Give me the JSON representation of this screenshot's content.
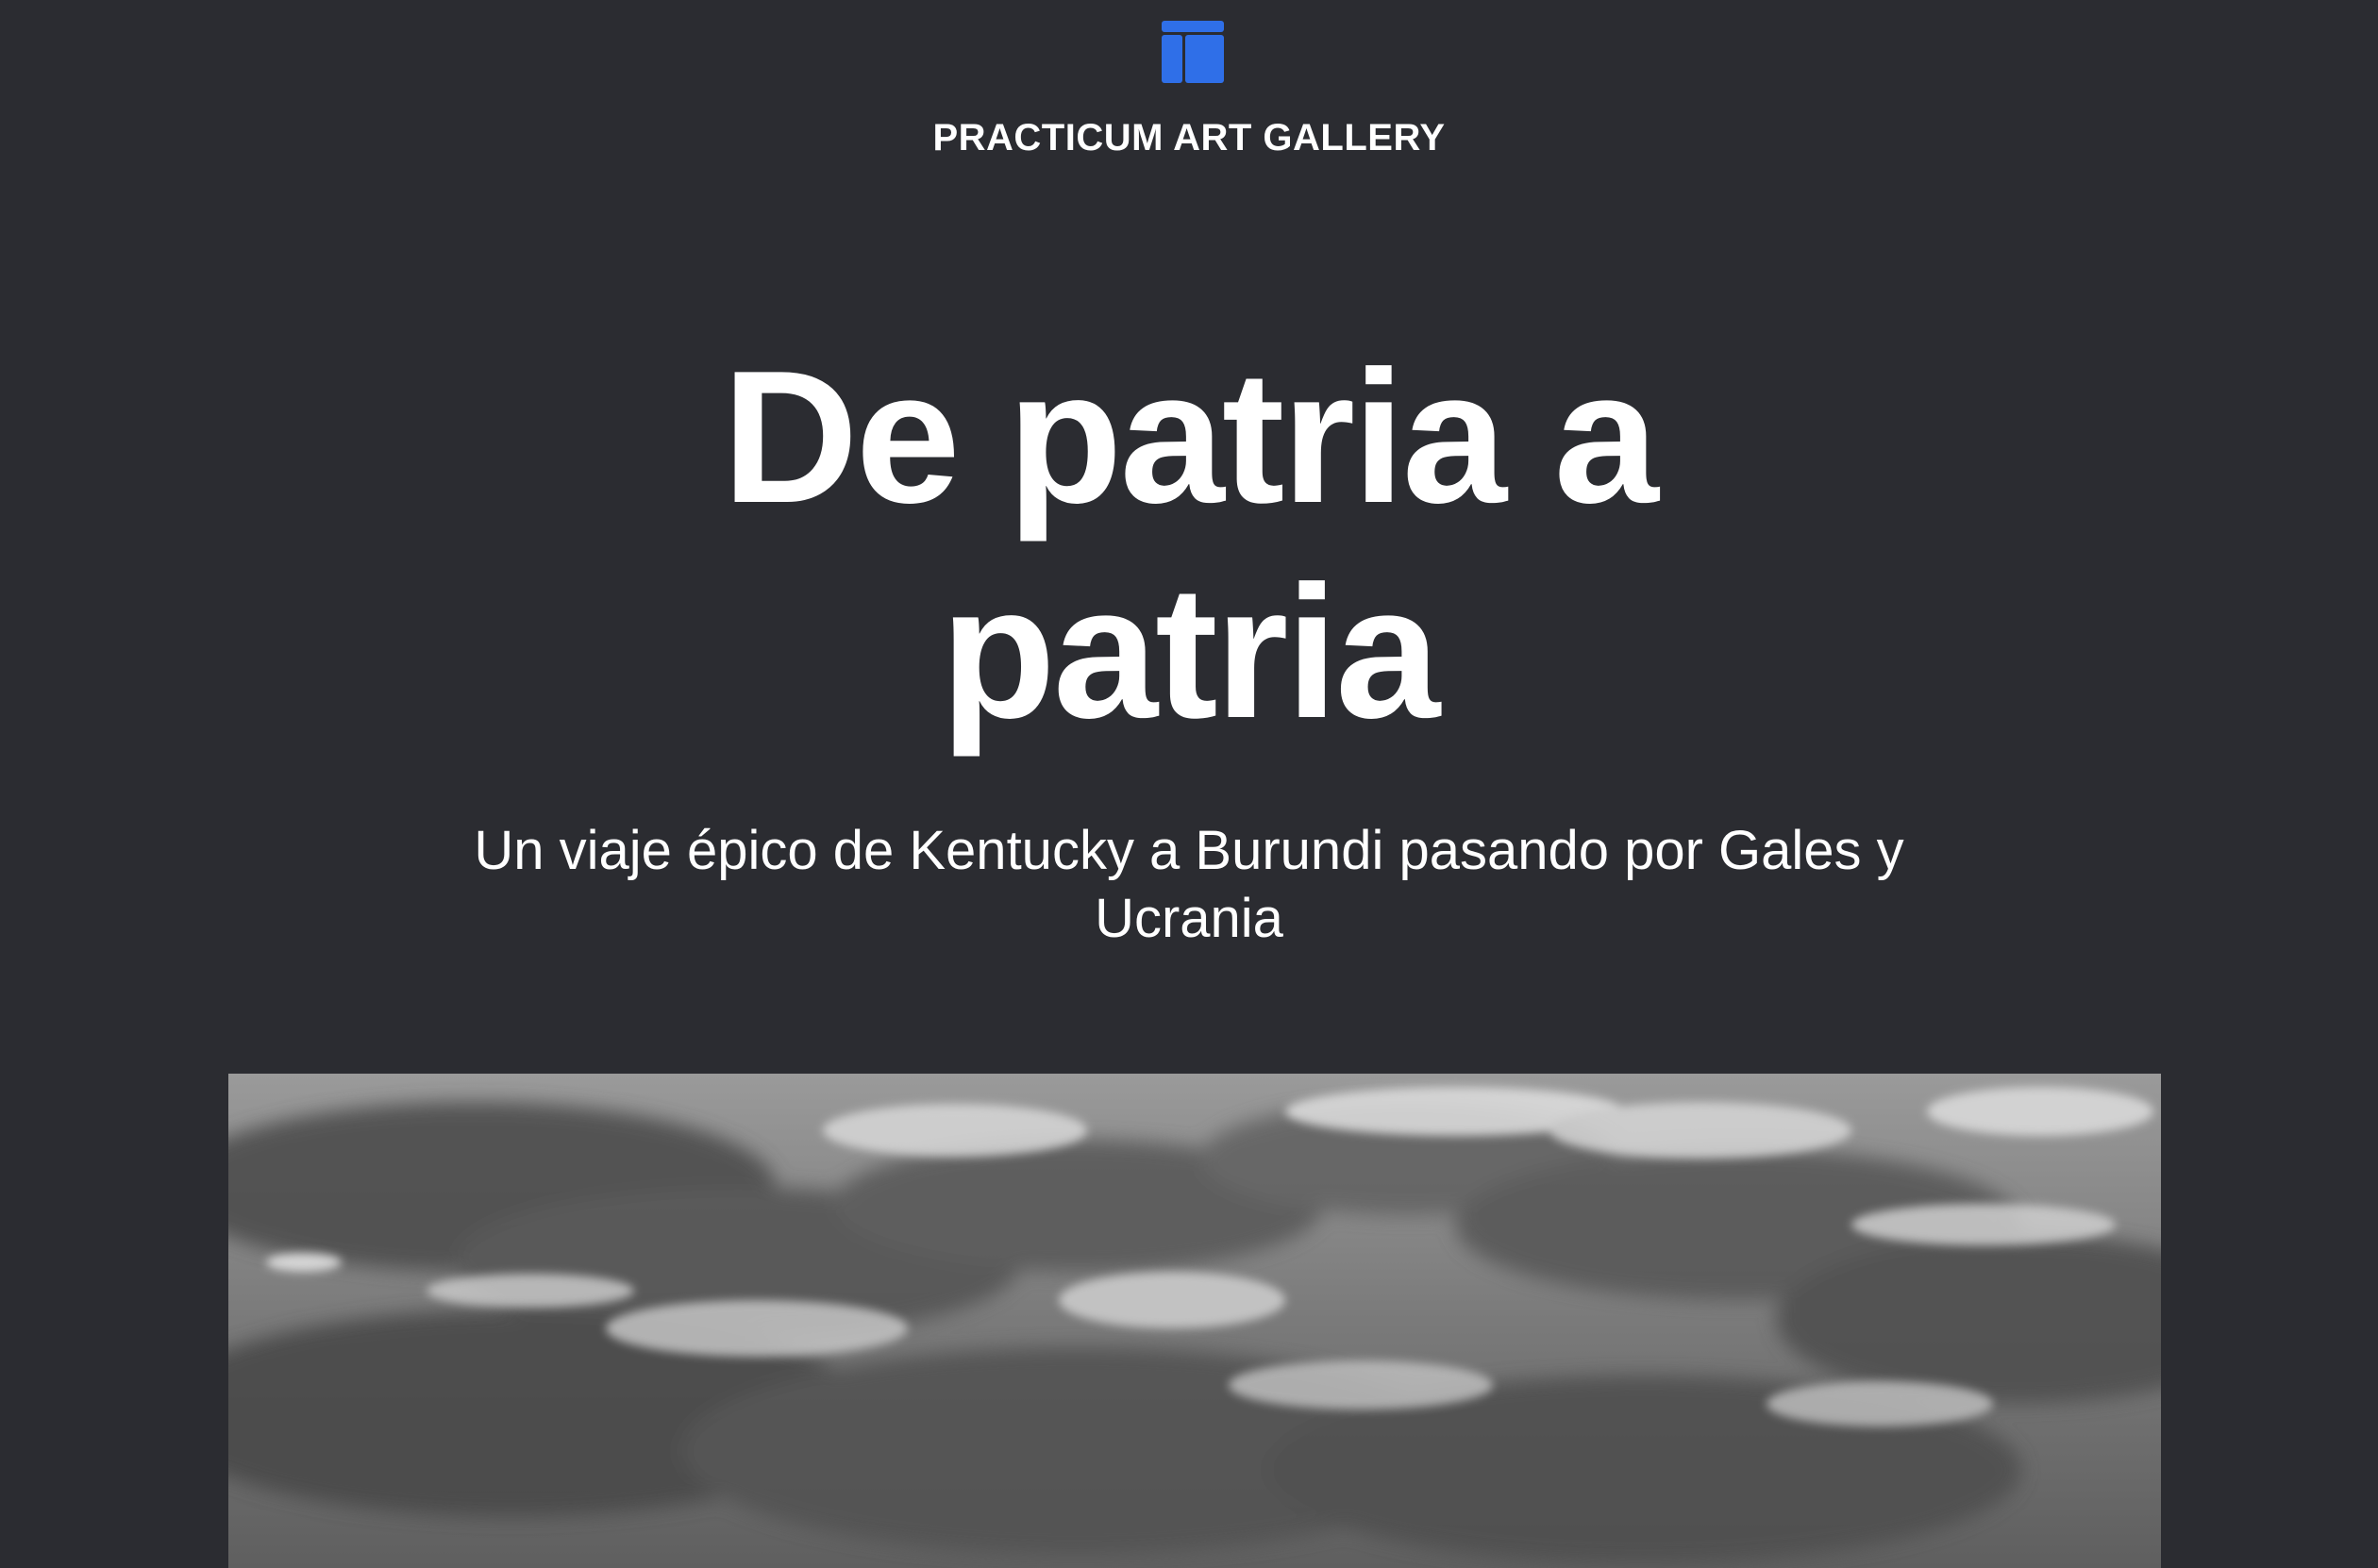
{
  "header": {
    "logo_icon": "gallery-layout-icon",
    "brand_name": "PRACTICUM ART GALLERY",
    "accent_color": "#2f6fe8"
  },
  "hero": {
    "title": "De patria a patria",
    "subtitle": "Un viaje épico de Kentucky a Burundi pasando por Gales y Ucrania",
    "image_description_icon": "cloudy-sky-image"
  },
  "colors": {
    "background": "#2b2c31",
    "text": "#ffffff"
  }
}
